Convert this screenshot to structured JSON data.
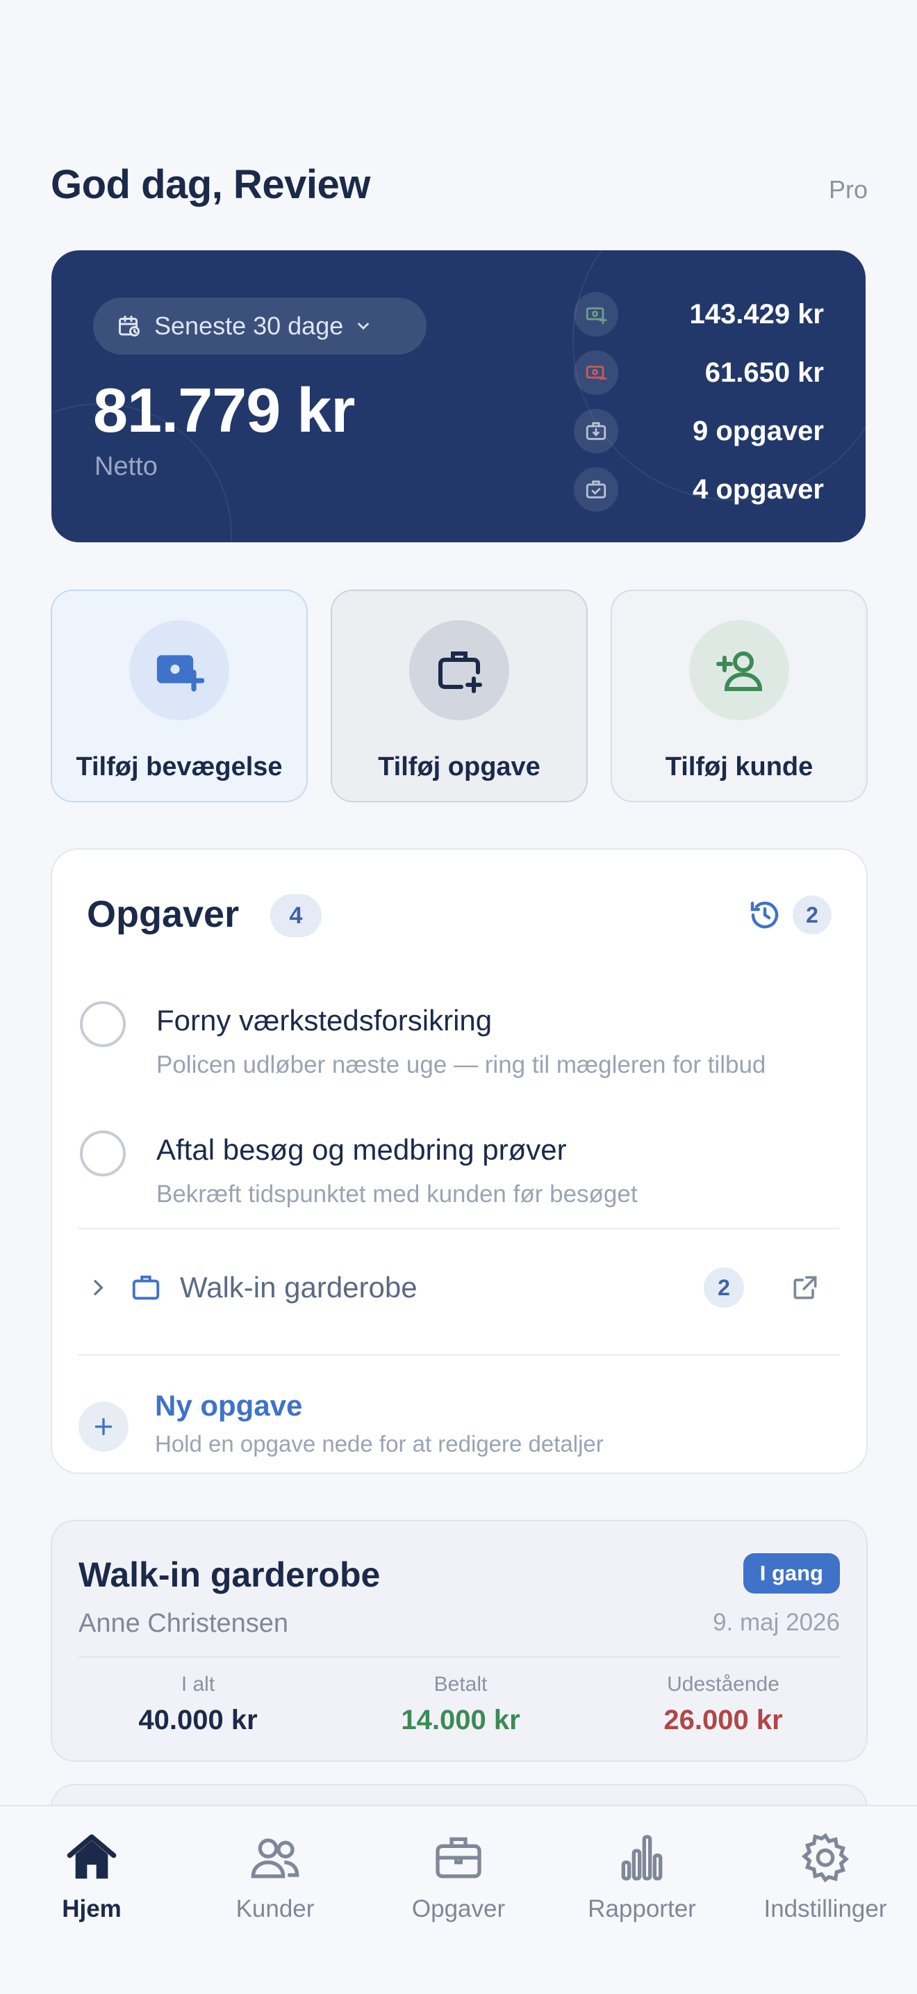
{
  "header": {
    "greeting": "God dag, Review",
    "plan": "Pro"
  },
  "summary": {
    "period": "Seneste 30 dage",
    "net_value": "81.779 kr",
    "net_label": "Netto",
    "stats": [
      {
        "icon": "income-icon",
        "value": "143.429 kr"
      },
      {
        "icon": "expense-icon",
        "value": "61.650 kr"
      },
      {
        "icon": "jobs-icon",
        "value": "9 opgaver"
      },
      {
        "icon": "completed-jobs-icon",
        "value": "4 opgaver"
      }
    ]
  },
  "actions": [
    {
      "label": "Tilføj bevægelse"
    },
    {
      "label": "Tilføj opgave"
    },
    {
      "label": "Tilføj kunde"
    }
  ],
  "tasks": {
    "title": "Opgaver",
    "count": "4",
    "history_count": "2",
    "items": [
      {
        "title": "Forny værkstedsforsikring",
        "desc": "Policen udløber næste uge — ring til mægleren for tilbud"
      },
      {
        "title": "Aftal besøg og medbring prøver",
        "desc": "Bekræft tidspunktet med kunden før besøget"
      }
    ],
    "job_group": {
      "title": "Walk-in garderobe",
      "count": "2"
    },
    "new_task": {
      "label": "Ny opgave",
      "hint": "Hold en opgave nede for at redigere detaljer"
    }
  },
  "job_card": {
    "title": "Walk-in garderobe",
    "status": "I gang",
    "customer": "Anne Christensen",
    "date": "9. maj 2026",
    "total_label": "I alt",
    "total_value": "40.000 kr",
    "paid_label": "Betalt",
    "paid_value": "14.000 kr",
    "due_label": "Udestående",
    "due_value": "26.000 kr"
  },
  "tabs": [
    {
      "label": "Hjem",
      "active": true
    },
    {
      "label": "Kunder"
    },
    {
      "label": "Opgaver"
    },
    {
      "label": "Rapporter"
    },
    {
      "label": "Indstillinger"
    }
  ],
  "colors": {
    "primary": "#22386a",
    "accent": "#3f72c9",
    "income": "#3c8a55",
    "expense": "#b24545"
  }
}
